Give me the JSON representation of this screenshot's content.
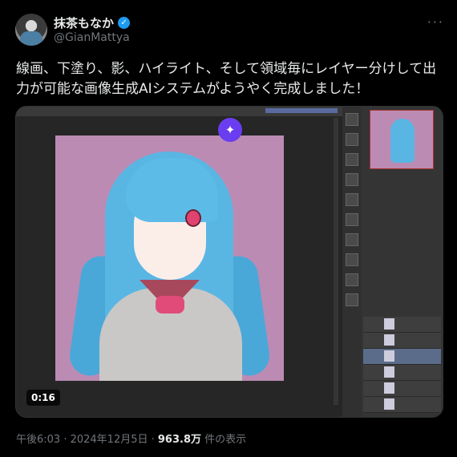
{
  "author": {
    "display_name": "抹茶もなか",
    "handle": "@GianMattya",
    "verified_icon": "verified-badge-icon"
  },
  "tweet": {
    "text": "線画、下塗り、影、ハイライト、そして領域毎にレイヤー分けして出力が可能な画像生成AIシステムがようやく完成しました！"
  },
  "media": {
    "type": "video",
    "duration": "0:16",
    "overlay_icon": "sparkle-icon"
  },
  "meta": {
    "timestamp": "午後6:03 · 2024年12月5日 · ",
    "views": "963.8万",
    "views_suffix": " 件の表示"
  },
  "more_icon": "more-options-icon",
  "colors": {
    "background": "#000000",
    "text": "#e7e9ea",
    "secondary_text": "#71767b",
    "verified": "#1d9bf0",
    "sparkle": "#6a3df0"
  }
}
